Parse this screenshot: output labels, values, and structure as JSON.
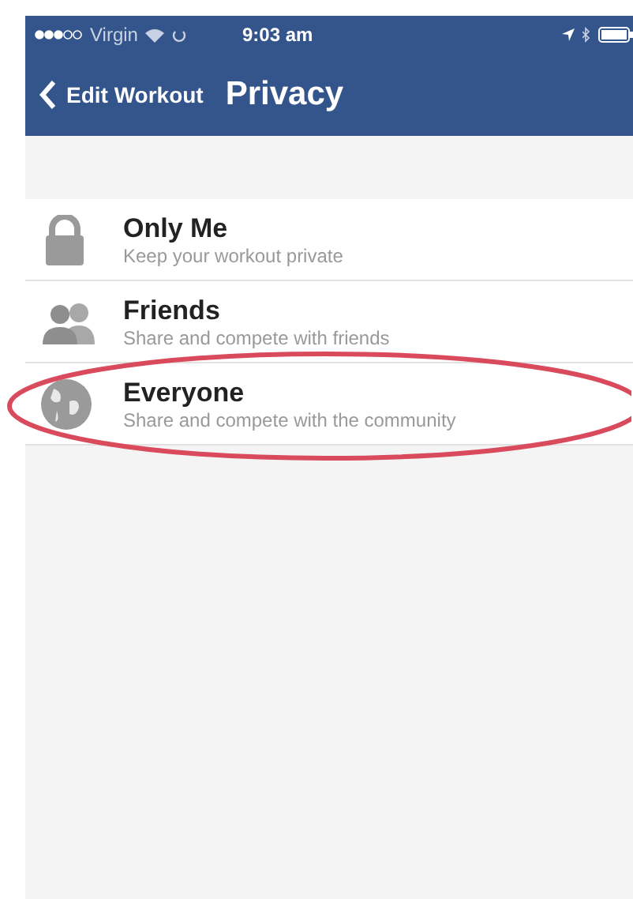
{
  "status_bar": {
    "carrier": "Virgin",
    "time": "9:03 am"
  },
  "nav_bar": {
    "back": "Edit Workout",
    "title": "Privacy"
  },
  "options": [
    {
      "title": "Only Me",
      "subtitle": "Keep your workout private"
    },
    {
      "title": "Friends",
      "subtitle": "Share and compete with friends"
    },
    {
      "title": "Everyone",
      "subtitle": "Share and compete with the community"
    }
  ]
}
